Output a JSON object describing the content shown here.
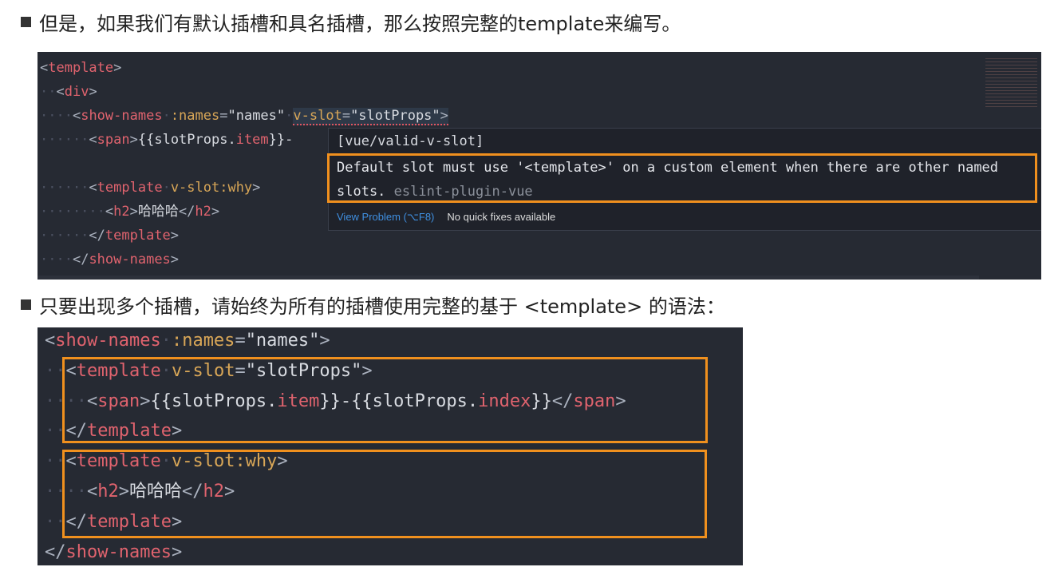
{
  "bullets": [
    "但是，如果我们有默认插槽和具名插槽，那么按照完整的template来编写。",
    "只要出现多个插槽，请始终为所有的插槽使用完整的基于 <template> 的语法："
  ],
  "editor": {
    "lines": [
      [
        [
          "p",
          "<"
        ],
        [
          "tag",
          "template"
        ],
        [
          "p",
          ">"
        ]
      ],
      [
        [
          "ind",
          "··"
        ],
        [
          "p",
          "<"
        ],
        [
          "tag",
          "div"
        ],
        [
          "p",
          ">"
        ]
      ],
      [
        [
          "ind",
          "····"
        ],
        [
          "p",
          "<"
        ],
        [
          "tag",
          "show-names"
        ],
        [
          "ind",
          "·"
        ],
        [
          "attr",
          ":names"
        ],
        [
          "p",
          "="
        ],
        [
          "str",
          "\"names\""
        ],
        [
          "ind",
          "·"
        ],
        [
          "attr",
          "v-slot"
        ],
        [
          "p",
          "="
        ],
        [
          "str",
          "\"slotProps\""
        ],
        [
          "p",
          ">"
        ]
      ],
      [
        [
          "ind",
          "······"
        ],
        [
          "p",
          "<"
        ],
        [
          "tag",
          "span"
        ],
        [
          "p",
          ">"
        ],
        [
          "txt",
          "{{slotProps."
        ],
        [
          "mem",
          "item"
        ],
        [
          "txt",
          "}}-"
        ]
      ],
      [],
      [
        [
          "ind",
          "······"
        ],
        [
          "p",
          "<"
        ],
        [
          "tag",
          "template"
        ],
        [
          "ind",
          "·"
        ],
        [
          "attr",
          "v-slot:why"
        ],
        [
          "p",
          ">"
        ]
      ],
      [
        [
          "ind",
          "········"
        ],
        [
          "p",
          "<"
        ],
        [
          "tag",
          "h2"
        ],
        [
          "p",
          ">"
        ],
        [
          "txt",
          "哈哈哈"
        ],
        [
          "p",
          "</"
        ],
        [
          "tag",
          "h2"
        ],
        [
          "p",
          ">"
        ]
      ],
      [
        [
          "ind",
          "······"
        ],
        [
          "p",
          "</"
        ],
        [
          "tag",
          "template"
        ],
        [
          "p",
          ">"
        ]
      ],
      [
        [
          "ind",
          "····"
        ],
        [
          "p",
          "</"
        ],
        [
          "tag",
          "show-names"
        ],
        [
          "p",
          ">"
        ]
      ]
    ],
    "popup": {
      "rule": "[vue/valid-v-slot]",
      "message": "Default slot must use '<template>' on a custom element when there are other named slots.",
      "source": "eslint-plugin-vue",
      "view_problem": "View Problem (⌥F8)",
      "no_fixes": "No quick fixes available"
    },
    "highlight_color": "#f0901e"
  },
  "example": {
    "lines": [
      [
        [
          "p",
          "<"
        ],
        [
          "tag",
          "show-names"
        ],
        [
          "ind",
          "·"
        ],
        [
          "attr",
          ":names"
        ],
        [
          "p",
          "="
        ],
        [
          "str",
          "\"names\""
        ],
        [
          "p",
          ">"
        ]
      ],
      [
        [
          "ind",
          "··"
        ],
        [
          "p",
          "<"
        ],
        [
          "tag",
          "template"
        ],
        [
          "ind",
          "·"
        ],
        [
          "attr",
          "v-slot"
        ],
        [
          "p",
          "="
        ],
        [
          "str",
          "\"slotProps\""
        ],
        [
          "p",
          ">"
        ]
      ],
      [
        [
          "ind",
          "····"
        ],
        [
          "p",
          "<"
        ],
        [
          "tag",
          "span"
        ],
        [
          "p",
          ">"
        ],
        [
          "txt",
          "{{slotProps."
        ],
        [
          "mem",
          "item"
        ],
        [
          "txt",
          "}}-{{slotProps."
        ],
        [
          "mem",
          "index"
        ],
        [
          "txt",
          "}}"
        ],
        [
          "p",
          "</"
        ],
        [
          "tag",
          "span"
        ],
        [
          "p",
          ">"
        ]
      ],
      [
        [
          "ind",
          "··"
        ],
        [
          "p",
          "</"
        ],
        [
          "tag",
          "template"
        ],
        [
          "p",
          ">"
        ]
      ],
      [
        [
          "ind",
          "··"
        ],
        [
          "p",
          "<"
        ],
        [
          "tag",
          "template"
        ],
        [
          "ind",
          "·"
        ],
        [
          "attr",
          "v-slot:why"
        ],
        [
          "p",
          ">"
        ]
      ],
      [
        [
          "ind",
          "····"
        ],
        [
          "p",
          "<"
        ],
        [
          "tag",
          "h2"
        ],
        [
          "p",
          ">"
        ],
        [
          "txt",
          "哈哈哈"
        ],
        [
          "p",
          "</"
        ],
        [
          "tag",
          "h2"
        ],
        [
          "p",
          ">"
        ]
      ],
      [
        [
          "ind",
          "··"
        ],
        [
          "p",
          "</"
        ],
        [
          "tag",
          "template"
        ],
        [
          "p",
          ">"
        ]
      ],
      [
        [
          "p",
          "</"
        ],
        [
          "tag",
          "show-names"
        ],
        [
          "p",
          ">"
        ]
      ]
    ]
  }
}
